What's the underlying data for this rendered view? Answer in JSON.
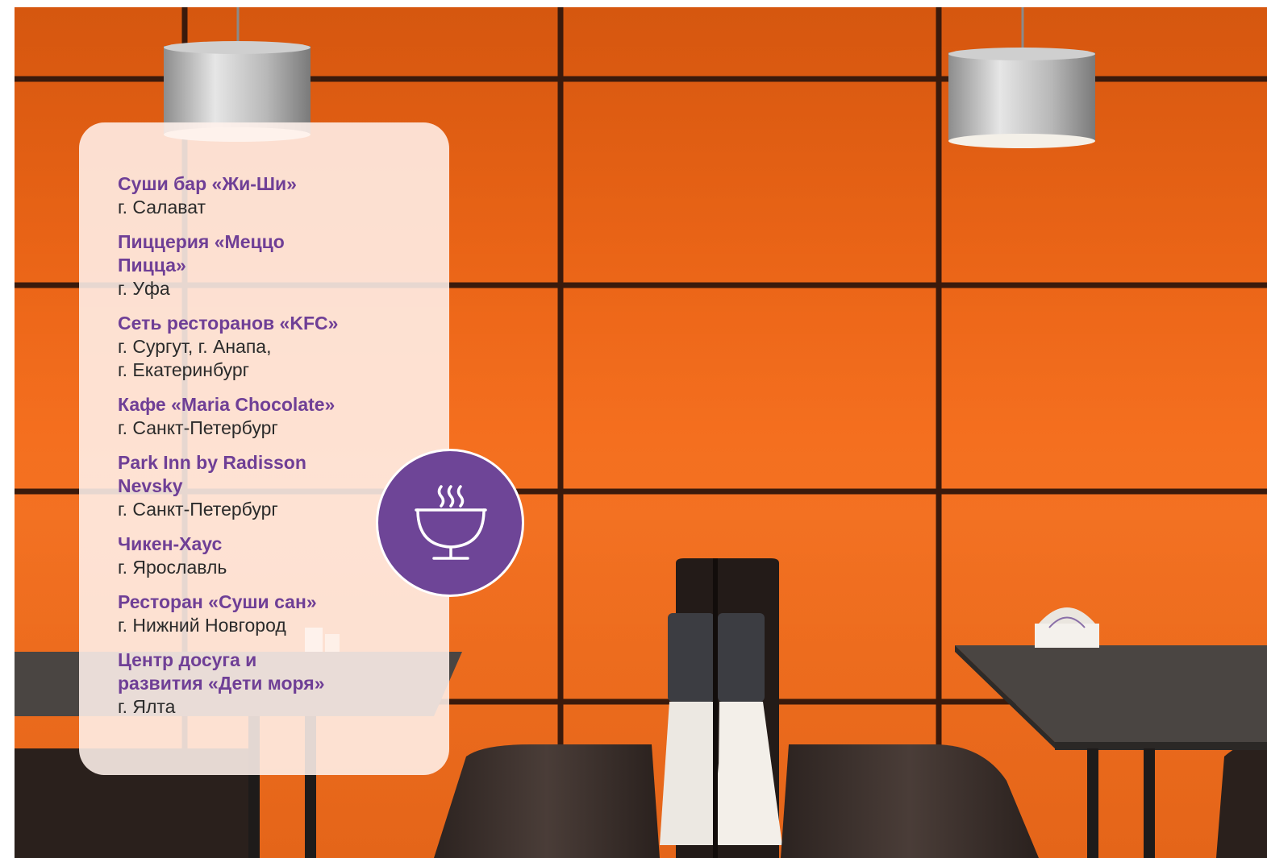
{
  "colors": {
    "accent_purple": "#6f3f96",
    "badge_purple": "#6e4597",
    "wall_orange": "#f26818",
    "city_text": "#2b2b2b"
  },
  "badge": {
    "icon": "soup-bowl-icon"
  },
  "venues": [
    {
      "name": "Суши бар «Жи-Ши»",
      "city": "г. Салават"
    },
    {
      "name": "Пиццерия «Меццо\nПицца»",
      "city": "г. Уфа"
    },
    {
      "name": "Сеть ресторанов «KFC»",
      "city": "г. Сургут, г. Анапа,\nг. Екатеринбург"
    },
    {
      "name": "Кафе «Maria Chocolate»",
      "city": "г. Санкт-Петербург"
    },
    {
      "name": "Park Inn by Radisson\nNevsky",
      "city": "г. Санкт-Петербург"
    },
    {
      "name": "Чикен-Хаус",
      "city": "г. Ярославль"
    },
    {
      "name": "Ресторан «Суши сан»",
      "city": "г. Нижний Новгород"
    },
    {
      "name": "Центр досуга и\nразвития «Дети моря»",
      "city": "г. Ялта"
    }
  ]
}
